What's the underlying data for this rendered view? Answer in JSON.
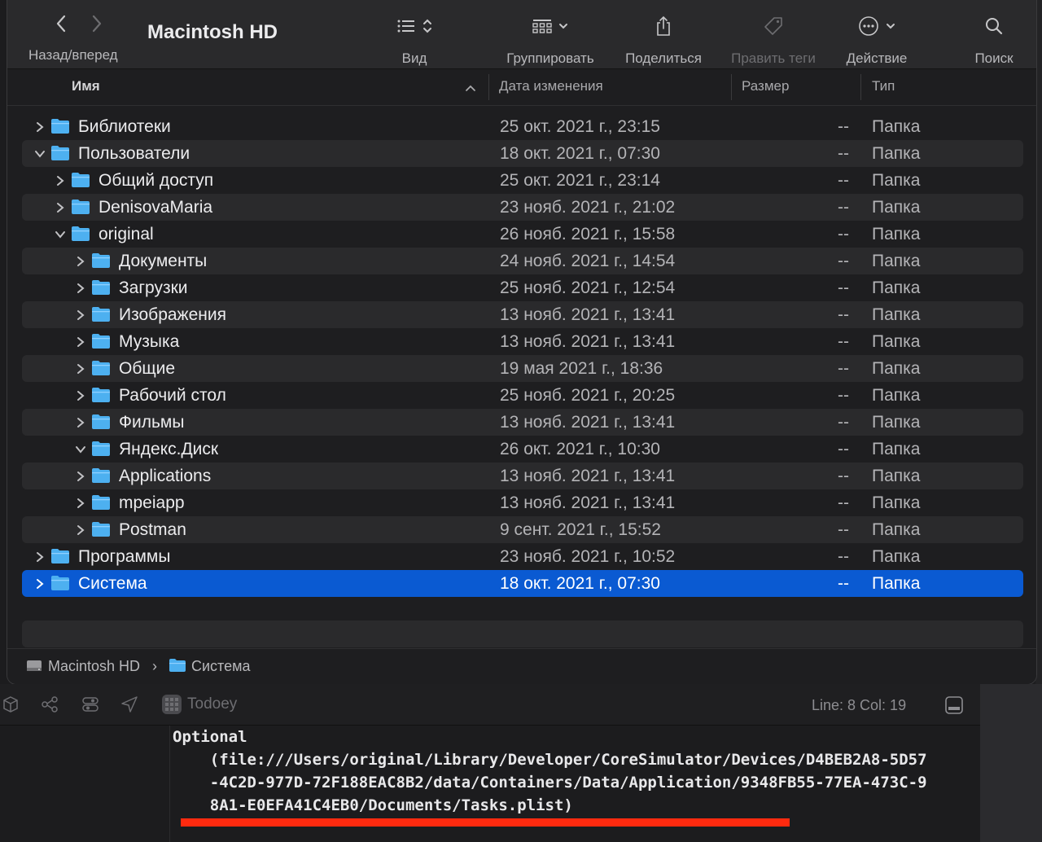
{
  "toolbar": {
    "nav_label": "Назад/вперед",
    "title": "Macintosh HD",
    "view_label": "Вид",
    "group_label": "Группировать",
    "share_label": "Поделиться",
    "tags_label": "Править теги",
    "action_label": "Действие",
    "search_label": "Поиск"
  },
  "columns": {
    "name": "Имя",
    "date": "Дата изменения",
    "size": "Размер",
    "kind": "Тип"
  },
  "rows": [
    {
      "name": "Библиотеки",
      "date": "25 окт. 2021 г., 23:15",
      "size": "--",
      "kind": "Папка",
      "expanded": false
    },
    {
      "name": "Пользователи",
      "date": "18 окт. 2021 г., 07:30",
      "size": "--",
      "kind": "Папка",
      "expanded": true
    },
    {
      "name": "Общий доступ",
      "date": "25 окт. 2021 г., 23:14",
      "size": "--",
      "kind": "Папка",
      "expanded": false
    },
    {
      "name": "DenisovaMaria",
      "date": "23 нояб. 2021 г., 21:02",
      "size": "--",
      "kind": "Папка",
      "expanded": false
    },
    {
      "name": "original",
      "date": "26 нояб. 2021 г., 15:58",
      "size": "--",
      "kind": "Папка",
      "expanded": true
    },
    {
      "name": "Документы",
      "date": "24 нояб. 2021 г., 14:54",
      "size": "--",
      "kind": "Папка",
      "expanded": false
    },
    {
      "name": "Загрузки",
      "date": "25 нояб. 2021 г., 12:54",
      "size": "--",
      "kind": "Папка",
      "expanded": false
    },
    {
      "name": "Изображения",
      "date": "13 нояб. 2021 г., 13:41",
      "size": "--",
      "kind": "Папка",
      "expanded": false
    },
    {
      "name": "Музыка",
      "date": "13 нояб. 2021 г., 13:41",
      "size": "--",
      "kind": "Папка",
      "expanded": false
    },
    {
      "name": "Общие",
      "date": "19 мая 2021 г., 18:36",
      "size": "--",
      "kind": "Папка",
      "expanded": false
    },
    {
      "name": "Рабочий стол",
      "date": "25 нояб. 2021 г., 20:25",
      "size": "--",
      "kind": "Папка",
      "expanded": false
    },
    {
      "name": "Фильмы",
      "date": "13 нояб. 2021 г., 13:41",
      "size": "--",
      "kind": "Папка",
      "expanded": false
    },
    {
      "name": "Яндекс.Диск",
      "date": "26 окт. 2021 г., 10:30",
      "size": "--",
      "kind": "Папка",
      "expanded": true
    },
    {
      "name": "Applications",
      "date": "13 нояб. 2021 г., 13:41",
      "size": "--",
      "kind": "Папка",
      "expanded": false
    },
    {
      "name": "mpeiapp",
      "date": "13 нояб. 2021 г., 13:41",
      "size": "--",
      "kind": "Папка",
      "expanded": false
    },
    {
      "name": "Postman",
      "date": "9 сент. 2021 г., 15:52",
      "size": "--",
      "kind": "Папка",
      "expanded": false
    },
    {
      "name": "Программы",
      "date": "23 нояб. 2021 г., 10:52",
      "size": "--",
      "kind": "Папка",
      "expanded": false
    },
    {
      "name": "Система",
      "date": "18 окт. 2021 г., 07:30",
      "size": "--",
      "kind": "Папка",
      "expanded": false,
      "selected": true
    }
  ],
  "pathbar": {
    "disk": "Macintosh HD",
    "separator": "›",
    "folder": "Система"
  },
  "xcode": {
    "app_name": "Todoey",
    "line_col": "Line: 8  Col: 19",
    "console_lines": [
      "Optional",
      "    (file:///Users/original/Library/Developer/CoreSimulator/Devices/D4BEB2A8-5D57",
      "    -4C2D-977D-72F188EAC8B2/data/Containers/Data/Application/9348FB55-77EA-473C-9",
      "    8A1-E0EFA41C4EB0/Documents/Tasks.plist)"
    ]
  },
  "colors": {
    "selection": "#0a5ad2",
    "folder": "#4db0f0",
    "underline": "#ff2a0f"
  }
}
